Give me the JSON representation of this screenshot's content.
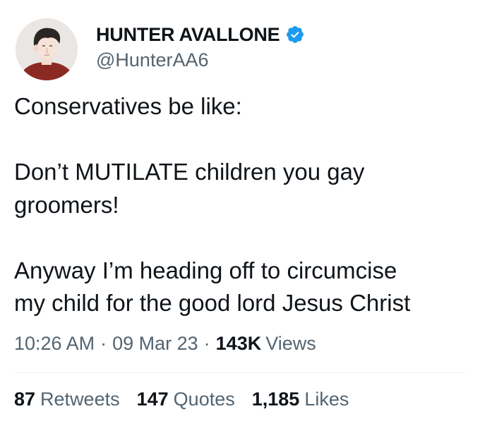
{
  "author": {
    "display_name": "HUNTER AVALLONE",
    "handle": "@HunterAA6",
    "verified_icon": "verified-badge-icon",
    "verified_color": "#1d9bf0",
    "avatar_icon": "user-avatar"
  },
  "tweet": {
    "line_1": "Conservatives be like:",
    "line_2": "Don’t MUTILATE children you gay",
    "line_3": "groomers!",
    "line_4": "Anyway I’m heading off to circumcise",
    "line_5": "my child for the good lord Jesus Christ"
  },
  "meta": {
    "time": "10:26 AM",
    "separator": "·",
    "date": "09 Mar 23",
    "views_count": "143K",
    "views_label": "Views"
  },
  "stats": {
    "retweets_count": "87",
    "retweets_label": "Retweets",
    "quotes_count": "147",
    "quotes_label": "Quotes",
    "likes_count": "1,185",
    "likes_label": "Likes"
  },
  "colors": {
    "text_primary": "#0f1419",
    "text_secondary": "#536471",
    "divider": "#eff3f4"
  }
}
